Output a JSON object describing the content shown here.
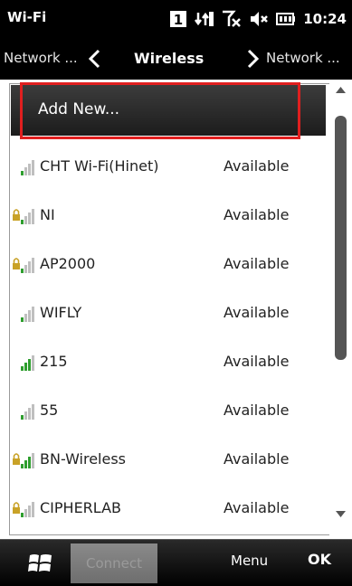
{
  "status_bar": {
    "app_title": "Wi-Fi",
    "icons": [
      "sim-1-icon",
      "data-arrows-icon",
      "no-signal-icon",
      "speaker-muted-icon",
      "battery-icon"
    ],
    "sim_label": "1",
    "time": "10:24"
  },
  "nav": {
    "left_label": "Network ...",
    "center_label": "Wireless",
    "right_label": "Network ..."
  },
  "list": {
    "add_new_label": "Add New...",
    "networks": [
      {
        "name": "CHT Wi-Fi(Hinet)",
        "status": "Available",
        "secured": false,
        "signal_bars": 1
      },
      {
        "name": "NI",
        "status": "Available",
        "secured": true,
        "signal_bars": 1
      },
      {
        "name": "AP2000",
        "status": "Available",
        "secured": true,
        "signal_bars": 1
      },
      {
        "name": "WIFLY",
        "status": "Available",
        "secured": false,
        "signal_bars": 1
      },
      {
        "name": "215",
        "status": "Available",
        "secured": false,
        "signal_bars": 3
      },
      {
        "name": "55",
        "status": "Available",
        "secured": false,
        "signal_bars": 1
      },
      {
        "name": "BN-Wireless",
        "status": "Available",
        "secured": true,
        "signal_bars": 3
      },
      {
        "name": "CIPHERLAB",
        "status": "Available",
        "secured": true,
        "signal_bars": 1
      }
    ]
  },
  "bottom_bar": {
    "connect_label": "Connect",
    "menu_label": "Menu",
    "ok_label": "OK"
  },
  "colors": {
    "highlight": "#e01f1f",
    "signal_on": "#2e9e2e",
    "signal_off": "#bfbfbf",
    "lock": "#c9a227"
  }
}
